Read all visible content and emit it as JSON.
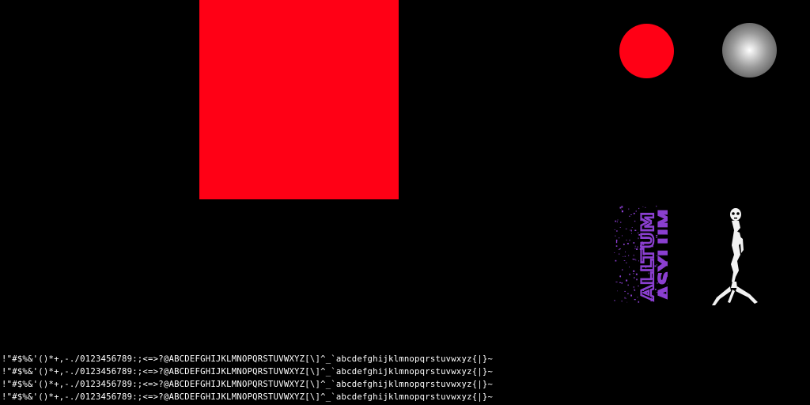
{
  "colors": {
    "background": "#000000",
    "primary_red": "#ff0015",
    "logo_purple": "#8a3fd0",
    "sphere_highlight": "#ffffff",
    "sphere_shadow": "#3a3a3a",
    "figure_white": "#f2f2f2"
  },
  "logo": {
    "text_line1": "ALLTUM",
    "text_line2": "ASYLUM"
  },
  "font_atlas": {
    "lines": [
      "!\"#$%&'()*+,-./0123456789:;<=>?@ABCDEFGHIJKLMNOPQRSTUVWXYZ[\\]^_`abcdefghijklmnopqrstuvwxyz{|}~",
      "!\"#$%&'()*+,-./0123456789:;<=>?@ABCDEFGHIJKLMNOPQRSTUVWXYZ[\\]^_`abcdefghijklmnopqrstuvwxyz{|}~",
      "!\"#$%&'()*+,-./0123456789:;<=>?@ABCDEFGHIJKLMNOPQRSTUVWXYZ[\\]^_`abcdefghijklmnopqrstuvwxyz{|}~",
      "!\"#$%&'()*+,-./0123456789:;<=>?@ABCDEFGHIJKLMNOPQRSTUVWXYZ[\\]^_`abcdefghijklmnopqrstuvwxyz{|}~"
    ]
  }
}
